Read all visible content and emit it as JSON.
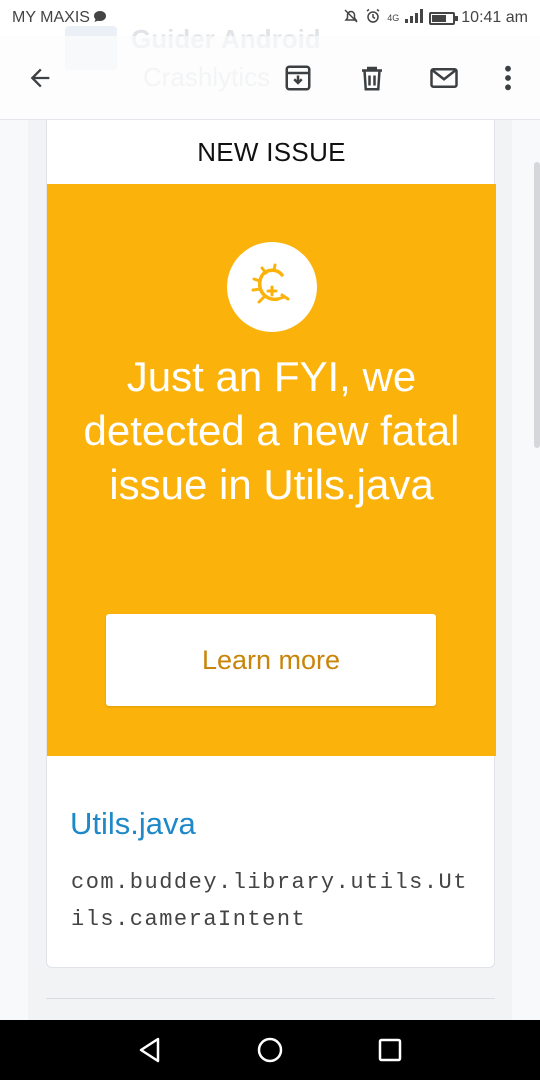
{
  "status_bar": {
    "carrier": "MY MAXIS",
    "network": "4G",
    "time": "10:41 am"
  },
  "ghost_header": {
    "line1": "Guider Android",
    "line2": "Crashlytics"
  },
  "toolbar": {
    "icons": [
      "back-arrow-icon",
      "archive-icon",
      "delete-icon",
      "mail-icon",
      "more-vert-icon"
    ]
  },
  "email": {
    "header": "NEW ISSUE",
    "banner": {
      "color": "#FBB20A",
      "icon": "crashlytics-bug-icon",
      "message": "Just an FYI, we detected a new fatal issue in Utils.java"
    },
    "learn_more_label": "Learn more",
    "file_link": "Utils.java",
    "method_signature": "com.buddey.library.utils.Utils.cameraIntent"
  },
  "nav_bar": {
    "icons": [
      "nav-back-icon",
      "nav-home-icon",
      "nav-recent-icon"
    ]
  }
}
